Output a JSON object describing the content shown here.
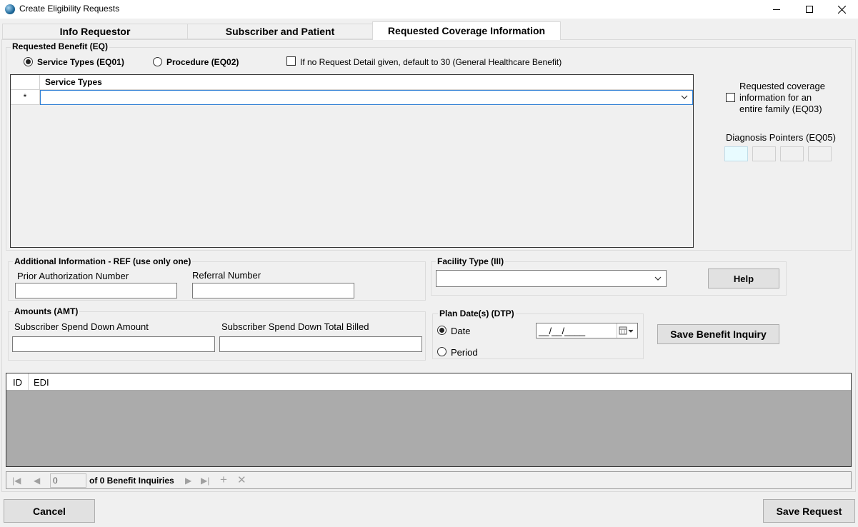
{
  "window": {
    "title": "Create Eligibility Requests"
  },
  "tabs": [
    {
      "label": "Info Requestor"
    },
    {
      "label": "Subscriber and Patient"
    },
    {
      "label": "Requested Coverage Information"
    }
  ],
  "requested_benefit": {
    "group_label": "Requested Benefit (EQ)",
    "service_types_radio": "Service Types (EQ01)",
    "procedure_radio": "Procedure (EQ02)",
    "default_checkbox": "If no Request Detail given, default to 30 (General Healthcare Benefit)",
    "grid_column": "Service Types",
    "new_row_marker": "*",
    "family_checkbox_line1": "Requested coverage",
    "family_checkbox_line2": "information for an",
    "family_checkbox_line3": "entire family (EQ03)",
    "diagnosis_label": "Diagnosis Pointers (EQ05)"
  },
  "additional_info": {
    "group_label": "Additional Information - REF (use only one)",
    "prior_auth_label": "Prior Authorization Number",
    "prior_auth_value": "",
    "referral_label": "Referral Number",
    "referral_value": ""
  },
  "facility": {
    "group_label": "Facility Type (III)",
    "value": "",
    "help_button": "Help"
  },
  "amounts": {
    "group_label": "Amounts (AMT)",
    "spend_down_label": "Subscriber Spend Down Amount",
    "spend_down_value": "",
    "total_billed_label": "Subscriber Spend Down Total Billed",
    "total_billed_value": ""
  },
  "plan_dates": {
    "group_label": "Plan Date(s) (DTP)",
    "date_radio": "Date",
    "period_radio": "Period",
    "date_value": "__/__/____"
  },
  "save_benefit_button": "Save Benefit Inquiry",
  "inquiry_list": {
    "columns": [
      "ID",
      "EDI"
    ]
  },
  "navigator": {
    "position": "0",
    "count_text": "of 0 Benefit Inquiries"
  },
  "footer": {
    "cancel": "Cancel",
    "save_request": "Save Request"
  },
  "colors": {
    "background": "#f0f0f0",
    "selected_field": "#e8fbff",
    "grid_focus": "#2f7fd4",
    "list_bg": "#ababab"
  }
}
